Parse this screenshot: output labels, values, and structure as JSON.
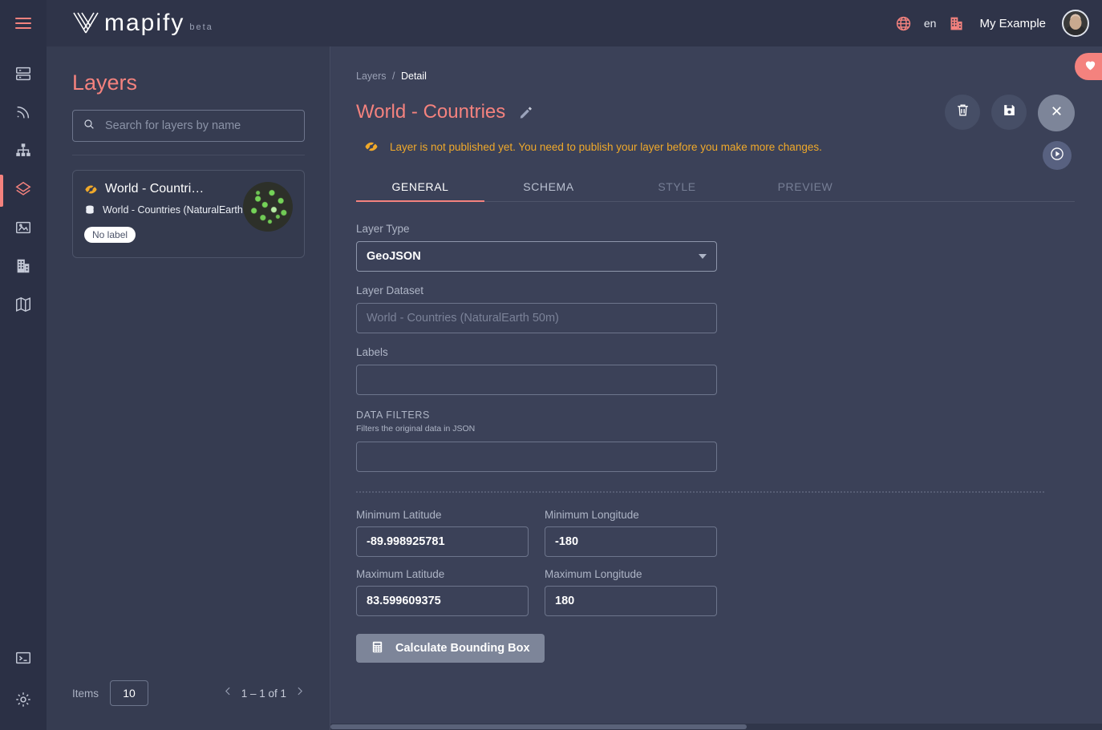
{
  "header": {
    "brand": "mapify",
    "brand_suffix": "beta",
    "menu_icon": "hamburger-icon",
    "language": "en",
    "organization": "My Example",
    "globe_icon": "globe-icon",
    "org_icon": "building-icon",
    "avatar_icon": "user-avatar"
  },
  "rail": {
    "items": [
      {
        "name": "sidebar-item-servers",
        "icon": "server-icon",
        "active": false
      },
      {
        "name": "sidebar-item-feeds",
        "icon": "rss-icon",
        "active": false
      },
      {
        "name": "sidebar-item-hierarchy",
        "icon": "sitemap-icon",
        "active": false
      },
      {
        "name": "sidebar-item-layers",
        "icon": "layers-icon",
        "active": true
      },
      {
        "name": "sidebar-item-images",
        "icon": "image-icon",
        "active": false
      },
      {
        "name": "sidebar-item-organizations",
        "icon": "building-icon",
        "active": false
      },
      {
        "name": "sidebar-item-maps",
        "icon": "map-icon",
        "active": false
      }
    ],
    "bottom_items": [
      {
        "name": "sidebar-item-console",
        "icon": "terminal-icon"
      },
      {
        "name": "sidebar-item-settings",
        "icon": "gear-icon"
      }
    ]
  },
  "left_panel": {
    "title": "Layers",
    "search": {
      "placeholder": "Search for layers by name",
      "value": "",
      "icon": "search-icon"
    },
    "cards": [
      {
        "title": "World - Countri…",
        "subtitle": "World - Countries (NaturalEarth …",
        "chip": "No label",
        "status_icon": "unpublished-icon",
        "dataset_icon": "database-icon"
      }
    ],
    "pager": {
      "items_label": "Items",
      "page_size": "10",
      "range": "1 – 1 of 1",
      "prev_icon": "chevron-left-icon",
      "next_icon": "chevron-right-icon"
    }
  },
  "main": {
    "breadcrumb": {
      "parent": "Layers",
      "separator": "/",
      "current": "Detail"
    },
    "page_title": "World - Countries",
    "edit_icon": "pencil-icon",
    "warning": {
      "icon": "unpublished-icon",
      "text": "Layer is not published yet. You need to publish your layer before you make more changes.",
      "color": "#f0a92a"
    },
    "tabs": [
      {
        "label": "GENERAL",
        "state": "active"
      },
      {
        "label": "SCHEMA",
        "state": "normal"
      },
      {
        "label": "STYLE",
        "state": "dim"
      },
      {
        "label": "PREVIEW",
        "state": "dim"
      }
    ],
    "actions": [
      {
        "name": "delete-button",
        "icon": "trash-icon"
      },
      {
        "name": "save-button",
        "icon": "floppy-disk-icon"
      },
      {
        "name": "close-button",
        "icon": "close-icon"
      }
    ],
    "publish_button": {
      "name": "publish-button",
      "icon": "play-circle-icon"
    },
    "favorite_tab": {
      "name": "favorites-tab",
      "icon": "heart-icon",
      "color": "#f4827e"
    },
    "form": {
      "layer_type": {
        "label": "Layer Type",
        "value": "GeoJSON",
        "caret": "chevron-down-icon"
      },
      "layer_dataset": {
        "label": "Layer Dataset",
        "value": "",
        "placeholder": "World - Countries (NaturalEarth 50m)"
      },
      "labels": {
        "label": "Labels",
        "value": ""
      },
      "data_filters": {
        "title": "DATA FILTERS",
        "subtitle": "Filters the original data in JSON",
        "value": ""
      },
      "min_latitude": {
        "label": "Minimum Latitude",
        "value": "-89.998925781"
      },
      "min_longitude": {
        "label": "Minimum Longitude",
        "value": "-180"
      },
      "max_latitude": {
        "label": "Maximum Latitude",
        "value": "83.599609375"
      },
      "max_longitude": {
        "label": "Maximum Longitude",
        "value": "180"
      },
      "calculate_button": {
        "label": "Calculate Bounding Box",
        "icon": "calculator-icon"
      }
    }
  },
  "theme": {
    "accent": "#f4827e",
    "background": "#363c51",
    "main_background": "#3b4158",
    "rail_background": "#2b3045",
    "warning": "#f0a92a"
  }
}
